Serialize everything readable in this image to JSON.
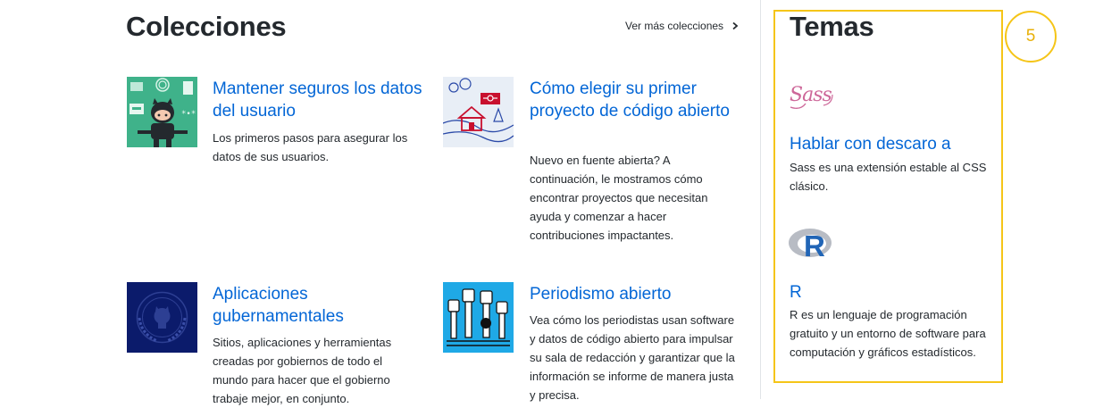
{
  "collections": {
    "heading": "Colecciones",
    "more_link": "Ver más colecciones",
    "items": [
      {
        "title": "Mantener seguros los datos del usuario",
        "description": "Los primeros pasos para asegurar los datos de sus usuarios."
      },
      {
        "title": "Cómo elegir su primer proyecto de código abierto",
        "description": "Nuevo en fuente abierta? A continuación, le mostramos cómo encontrar proyectos que necesitan ayuda y comenzar a hacer contribuciones impactantes."
      },
      {
        "title": "Aplicaciones gubernamentales",
        "description": "Sitios, aplicaciones y herramientas creadas por gobiernos de todo el mundo para hacer que el gobierno trabaje mejor, en conjunto."
      },
      {
        "title": "Periodismo abierto",
        "description": "Vea cómo los periodistas usan software y datos de código abierto para impulsar su sala de redacción y garantizar que la información se informe de manera justa y precisa."
      }
    ]
  },
  "topics": {
    "heading": "Temas",
    "items": [
      {
        "logo_text": "Sass",
        "title": "Hablar con descaro a",
        "description": "Sass es una extensión estable al CSS clásico."
      },
      {
        "logo_text": "R",
        "title": "R",
        "description": "R es un lenguaje de programación gratuito y un entorno de software para computación y gráficos estadísticos."
      }
    ]
  },
  "annotation": {
    "label": "5",
    "color": "#f5c518"
  },
  "colors": {
    "link": "#0366d6",
    "text": "#24292e",
    "thumb_green": "#3fb28a",
    "thumb_navy": "#0b1b6b",
    "thumb_cyan": "#1fa9e6",
    "sass_pink": "#cd6799"
  }
}
